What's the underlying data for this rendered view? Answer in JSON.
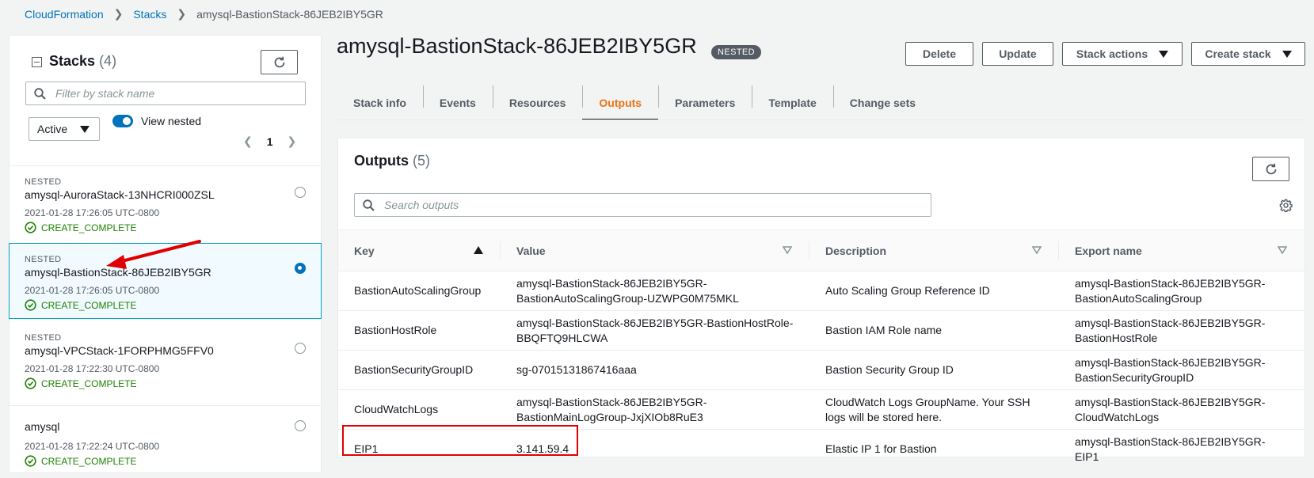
{
  "breadcrumb": {
    "items": [
      "CloudFormation",
      "Stacks"
    ],
    "current": "amysql-BastionStack-86JEB2IBY5GR"
  },
  "sidebar": {
    "title": "Stacks",
    "count": "(4)",
    "filter_placeholder": "Filter by stack name",
    "status_filter": "Active",
    "view_nested_label": "View nested",
    "page": "1",
    "stacks": [
      {
        "badge": "NESTED",
        "name": "amysql-AuroraStack-13NHCRI000ZSL",
        "time": "2021-01-28 17:26:05 UTC-0800",
        "status": "CREATE_COMPLETE",
        "selected": false
      },
      {
        "badge": "NESTED",
        "name": "amysql-BastionStack-86JEB2IBY5GR",
        "time": "2021-01-28 17:26:05 UTC-0800",
        "status": "CREATE_COMPLETE",
        "selected": true
      },
      {
        "badge": "NESTED",
        "name": "amysql-VPCStack-1FORPHMG5FFV0",
        "time": "2021-01-28 17:22:30 UTC-0800",
        "status": "CREATE_COMPLETE",
        "selected": false
      },
      {
        "badge": "",
        "name": "amysql",
        "time": "2021-01-28 17:22:24 UTC-0800",
        "status": "CREATE_COMPLETE",
        "selected": false
      }
    ]
  },
  "header": {
    "title": "amysql-BastionStack-86JEB2IBY5GR",
    "badge": "NESTED",
    "buttons": {
      "delete": "Delete",
      "update": "Update",
      "stack_actions": "Stack actions",
      "create_stack": "Create stack"
    }
  },
  "tabs": [
    "Stack info",
    "Events",
    "Resources",
    "Outputs",
    "Parameters",
    "Template",
    "Change sets"
  ],
  "active_tab": "Outputs",
  "outputs": {
    "title": "Outputs",
    "count": "(5)",
    "search_placeholder": "Search outputs",
    "columns": [
      "Key",
      "Value",
      "Description",
      "Export name"
    ],
    "rows": [
      {
        "key": "BastionAutoScalingGroup",
        "value": "amysql-BastionStack-86JEB2IBY5GR-BastionAutoScalingGroup-UZWPG0M75MKL",
        "value_l1": "amysql-BastionStack-86JEB2IBY5GR-",
        "value_l2": "BastionAutoScalingGroup-UZWPG0M75MKL",
        "desc_l1": "Auto Scaling Group Reference ID",
        "desc_l2": "",
        "export_l1": "amysql-BastionStack-86JEB2IBY5GR-",
        "export_l2": "BastionAutoScalingGroup"
      },
      {
        "key": "BastionHostRole",
        "value_l1": "amysql-BastionStack-86JEB2IBY5GR-BastionHostRole-",
        "value_l2": "BBQFTQ9HLCWA",
        "desc_l1": "Bastion IAM Role name",
        "desc_l2": "",
        "export_l1": "amysql-BastionStack-86JEB2IBY5GR-",
        "export_l2": "BastionHostRole"
      },
      {
        "key": "BastionSecurityGroupID",
        "value_l1": "sg-07015131867416aaa",
        "value_l2": "",
        "desc_l1": "Bastion Security Group ID",
        "desc_l2": "",
        "export_l1": "amysql-BastionStack-86JEB2IBY5GR-",
        "export_l2": "BastionSecurityGroupID"
      },
      {
        "key": "CloudWatchLogs",
        "value_l1": "amysql-BastionStack-86JEB2IBY5GR-",
        "value_l2": "BastionMainLogGroup-JxjXIOb8RuE3",
        "desc_l1": "CloudWatch Logs GroupName. Your SSH",
        "desc_l2": "logs will be stored here.",
        "export_l1": "amysql-BastionStack-86JEB2IBY5GR-",
        "export_l2": "CloudWatchLogs"
      },
      {
        "key": "EIP1",
        "value_l1": "3.141.59.4",
        "value_l2": "",
        "desc_l1": "Elastic IP 1 for Bastion",
        "desc_l2": "",
        "export_l1": "amysql-BastionStack-86JEB2IBY5GR-EIP1",
        "export_l2": ""
      }
    ]
  },
  "colors": {
    "link": "#0073bb",
    "active_tab": "#ec7211",
    "success": "#1d8102",
    "annotation": "#e00000"
  }
}
